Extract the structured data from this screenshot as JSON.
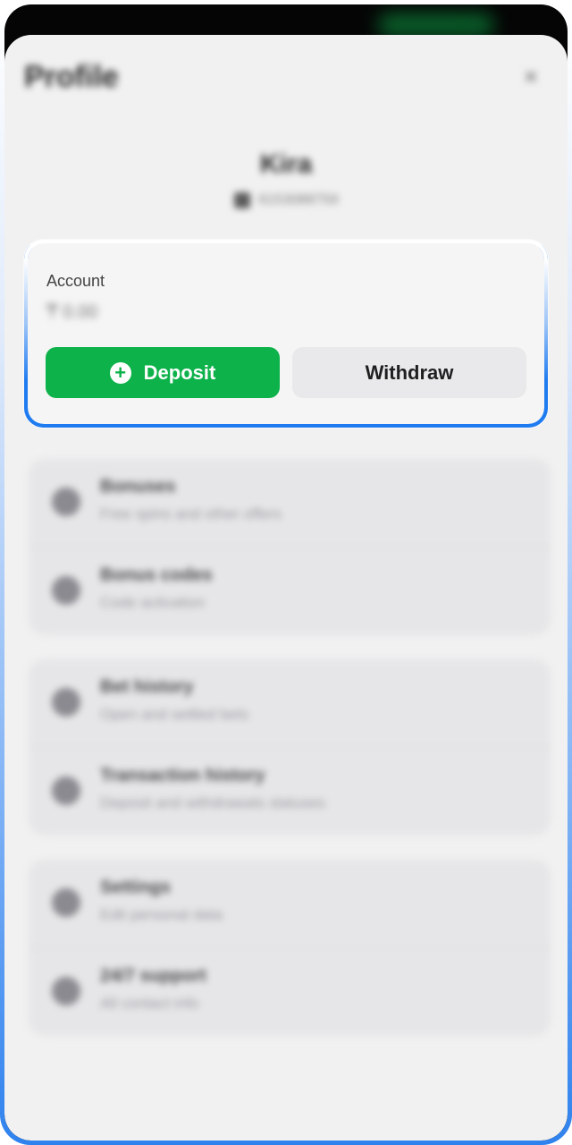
{
  "header": {
    "title": "Profile",
    "close_label": "×"
  },
  "user": {
    "name": "Kira",
    "id": "6153088759"
  },
  "account": {
    "label": "Account",
    "balance": "₸ 0.00",
    "deposit_label": "Deposit",
    "withdraw_label": "Withdraw"
  },
  "menu": {
    "groups": [
      {
        "items": [
          {
            "title": "Bonuses",
            "subtitle": "Free spins and other offers",
            "icon": "gift-icon"
          },
          {
            "title": "Bonus codes",
            "subtitle": "Code activation",
            "icon": "ticket-icon"
          }
        ]
      },
      {
        "items": [
          {
            "title": "Bet history",
            "subtitle": "Open and settled bets",
            "icon": "clock-icon"
          },
          {
            "title": "Transaction history",
            "subtitle": "Deposit and withdrawals statuses",
            "icon": "search-icon"
          }
        ]
      },
      {
        "items": [
          {
            "title": "Settings",
            "subtitle": "Edit personal data",
            "icon": "gear-icon"
          },
          {
            "title": "24/7 support",
            "subtitle": "All contact info",
            "icon": "headset-icon"
          }
        ]
      }
    ]
  },
  "colors": {
    "deposit": "#0db24a",
    "withdraw_bg": "#e9e9eb",
    "highlight_border": "#1f7cf0"
  }
}
